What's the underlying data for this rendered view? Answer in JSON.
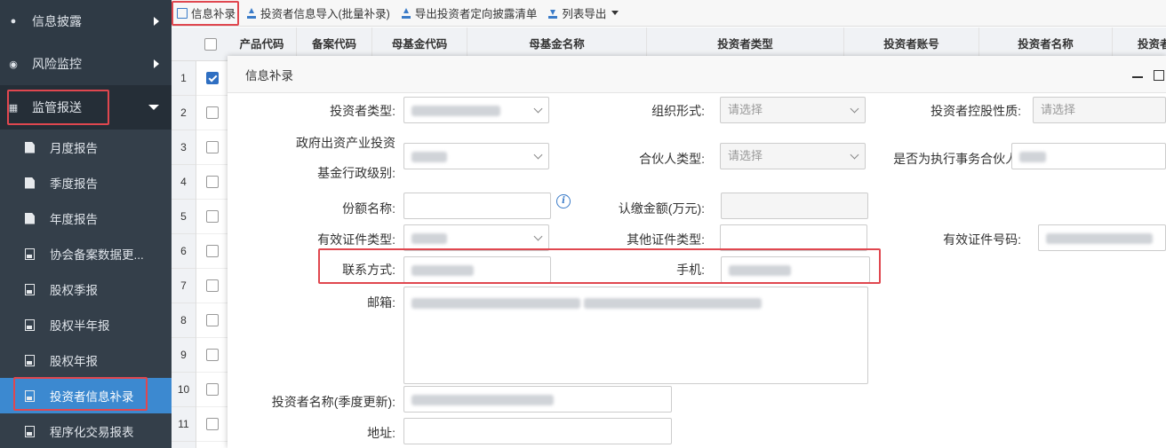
{
  "sidebar": {
    "top_items": [
      {
        "label": "信息披露",
        "icon": "info-icon"
      },
      {
        "label": "风险监控",
        "icon": "eye-icon"
      },
      {
        "label": "监管报送",
        "icon": "grid-icon"
      }
    ],
    "sub_items": [
      {
        "label": "月度报告",
        "icon": "document-icon"
      },
      {
        "label": "季度报告",
        "icon": "document-icon"
      },
      {
        "label": "年度报告",
        "icon": "document-icon"
      },
      {
        "label": "协会备案数据更...",
        "icon": "image-document-icon"
      },
      {
        "label": "股权季报",
        "icon": "image-document-icon"
      },
      {
        "label": "股权半年报",
        "icon": "image-document-icon"
      },
      {
        "label": "股权年报",
        "icon": "image-document-icon"
      },
      {
        "label": "投资者信息补录",
        "icon": "image-document-icon"
      },
      {
        "label": "程序化交易报表",
        "icon": "image-document-icon"
      }
    ]
  },
  "toolbar": {
    "info_supplement": "信息补录",
    "import_investor": "投资者信息导入(批量补录)",
    "export_disclosure": "导出投资者定向披露清单",
    "list_export": "列表导出"
  },
  "grid": {
    "columns": [
      "产品代码",
      "备案代码",
      "母基金代码",
      "母基金名称",
      "投资者类型",
      "投资者账号",
      "投资者名称",
      "投资者"
    ],
    "row_numbers": [
      "1",
      "2",
      "3",
      "4",
      "5",
      "6",
      "7",
      "8",
      "9",
      "10",
      "11"
    ]
  },
  "modal": {
    "title": "信息补录",
    "fields": {
      "investor_type": "投资者类型:",
      "org_form": "组织形式:",
      "org_form_placeholder": "请选择",
      "control_nature": "投资者控股性质:",
      "control_nature_placeholder": "请选择",
      "gov_level_line1": "政府出资产业投资",
      "gov_level_line2": "基金行政级别:",
      "partner_type": "合伙人类型:",
      "partner_type_placeholder": "请选择",
      "exec_partner": "是否为执行事务合伙人:",
      "share_name": "份额名称:",
      "subscribed_amount": "认缴金额(万元):",
      "id_type": "有效证件类型:",
      "other_id_type": "其他证件类型:",
      "id_number": "有效证件号码:",
      "contact": "联系方式:",
      "mobile": "手机:",
      "email": "邮箱:",
      "investor_name_quarterly": "投资者名称(季度更新):",
      "address": "地址:"
    }
  },
  "colors": {
    "sidebar_bg": "#2f3a45",
    "active_blue": "#3c89d0",
    "highlight_red": "#e0474f"
  }
}
